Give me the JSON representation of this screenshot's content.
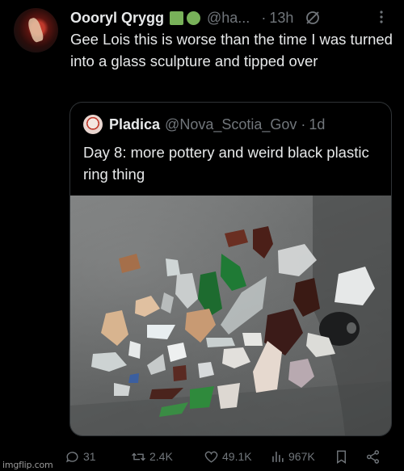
{
  "tweet": {
    "author_name": "Oooryl Qrygg",
    "author_handle": "@ha...",
    "separator": "·",
    "time": "13h",
    "text": "Gee Lois this is worse than the time I was turned into a glass sculpture and tipped over",
    "badge_emojis": [
      "green-square-emoji",
      "green-circle-emoji"
    ]
  },
  "quote": {
    "author_name": "Pladica",
    "author_handle": "@Nova_Scotia_Gov",
    "separator": "·",
    "time": "1d",
    "text": "Day 8: more pottery and weird black plastic ring thing",
    "photo_subject": "sea glass and pottery pieces on grey surface"
  },
  "actions": {
    "replies": "31",
    "reposts": "2.4K",
    "likes": "49.1K",
    "views": "967K",
    "icons": [
      "reply-icon",
      "repost-icon",
      "like-icon",
      "views-icon",
      "bookmark-icon",
      "share-icon"
    ]
  },
  "watermark": "imgflip.com",
  "colors": {
    "background": "#000000",
    "text": "#e7e9ea",
    "secondary_text": "#71767b",
    "border": "#2f3336"
  }
}
